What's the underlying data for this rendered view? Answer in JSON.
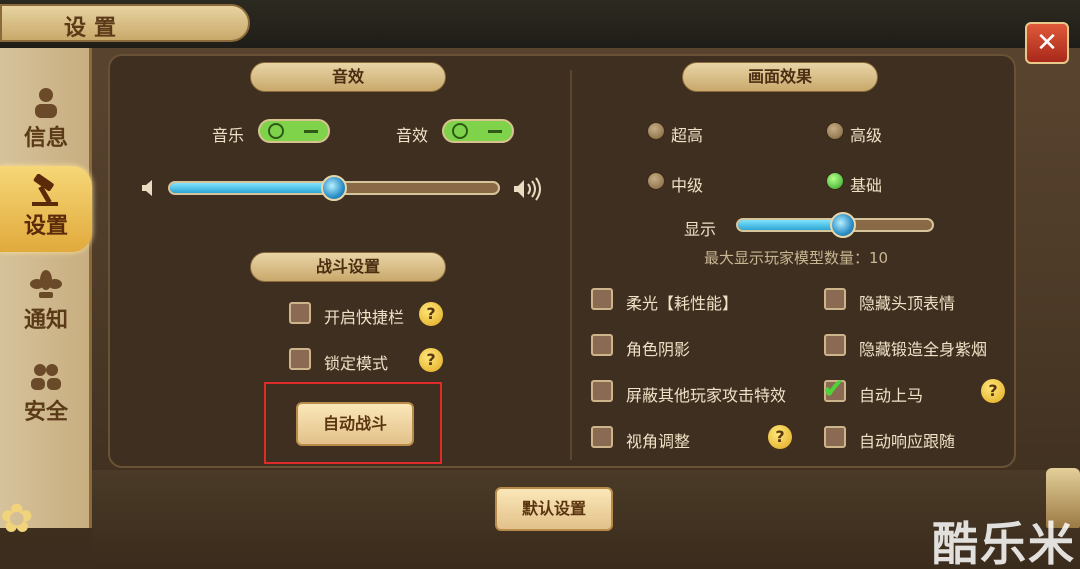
{
  "window": {
    "title": "设置",
    "close_glyph": "✕",
    "close_icon": "close-icon"
  },
  "sidebar": {
    "items": [
      {
        "label": "信息",
        "icon": "person-icon",
        "active": false
      },
      {
        "label": "设置",
        "icon": "hammer-icon",
        "active": true
      },
      {
        "label": "通知",
        "icon": "lotus-icon",
        "active": false
      },
      {
        "label": "安全",
        "icon": "group-icon",
        "active": false
      }
    ]
  },
  "sound": {
    "title": "音效",
    "music_label": "音乐",
    "music_on": true,
    "effect_label": "音效",
    "effect_on": true,
    "volume_fraction": 0.5
  },
  "battle": {
    "title": "战斗设置",
    "quickbar_label": "开启快捷栏",
    "quickbar_checked": false,
    "lock_label": "锁定模式",
    "lock_checked": false,
    "auto_battle_label": "自动战斗"
  },
  "graphics": {
    "title": "画面效果",
    "options": [
      {
        "label": "超高",
        "selected": false
      },
      {
        "label": "高级",
        "selected": false
      },
      {
        "label": "中级",
        "selected": false
      },
      {
        "label": "基础",
        "selected": true
      }
    ],
    "display_label": "显示",
    "display_fraction": 0.54,
    "max_players_text": "最大显示玩家模型数量：10",
    "checkboxes": [
      {
        "label": "柔光【耗性能】",
        "checked": false
      },
      {
        "label": "隐藏头顶表情",
        "checked": false
      },
      {
        "label": "角色阴影",
        "checked": false
      },
      {
        "label": "隐藏锻造全身紫烟",
        "checked": false
      },
      {
        "label": "屏蔽其他玩家攻击特效",
        "checked": false
      },
      {
        "label": "自动上马",
        "checked": true
      },
      {
        "label": "视角调整",
        "checked": false
      },
      {
        "label": "自动响应跟随",
        "checked": false
      }
    ]
  },
  "footer": {
    "default_button": "默认设置"
  },
  "watermark": "酷乐米",
  "colors": {
    "accent_gold": "#e1aa3c",
    "toggle_green": "#7ed34a",
    "slider_blue": "#2ea6d4",
    "close_red": "#c83a22",
    "highlight_red": "#e02b2b"
  }
}
